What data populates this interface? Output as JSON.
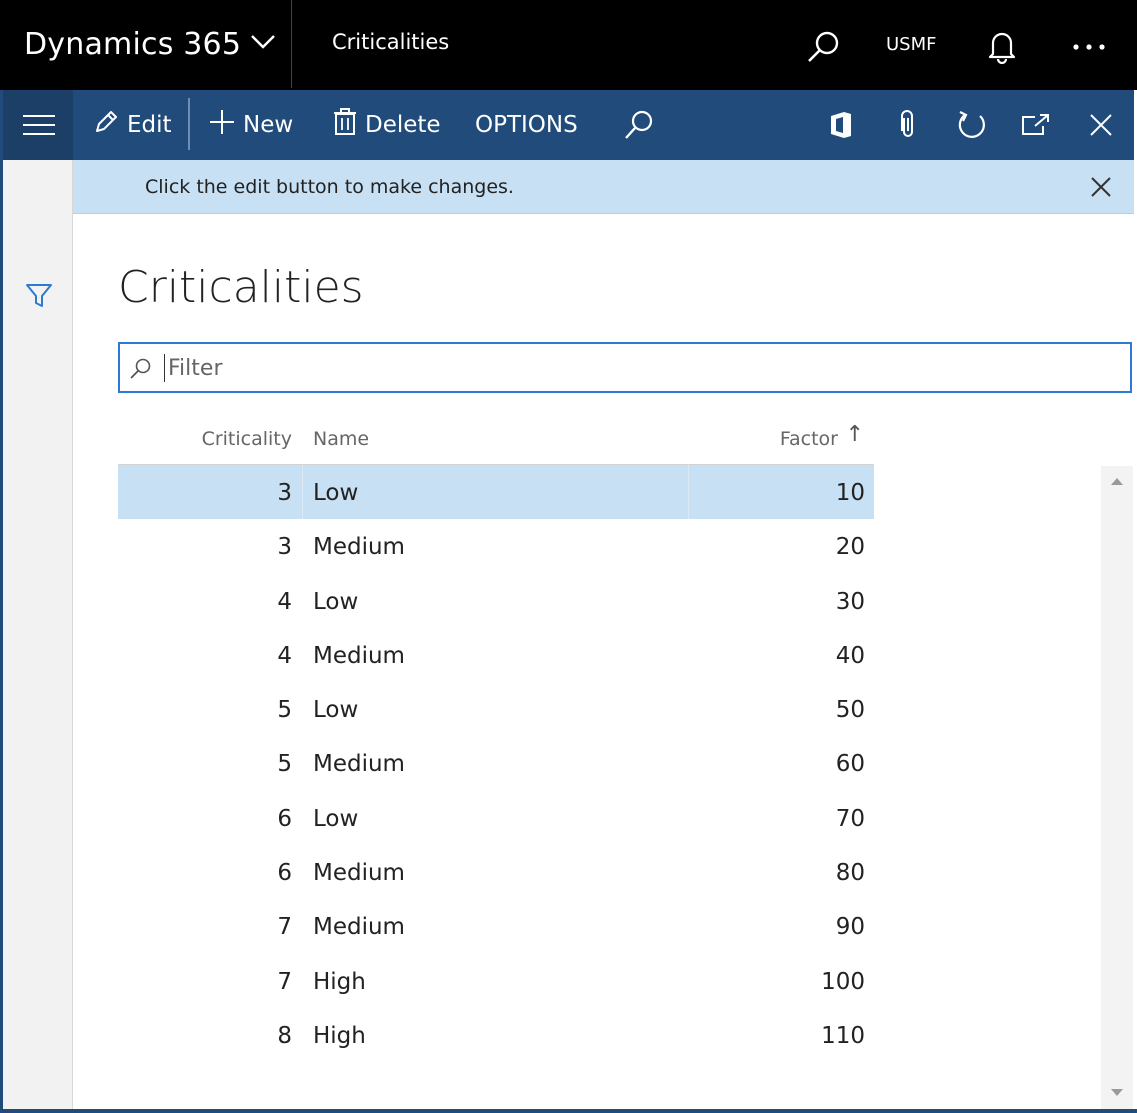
{
  "header": {
    "app_name": "Dynamics 365",
    "page_title": "Criticalities",
    "company": "USMF"
  },
  "actions": {
    "edit": "Edit",
    "new": "New",
    "delete": "Delete",
    "options": "OPTIONS"
  },
  "message": {
    "text": "Click the edit button to make changes."
  },
  "page": {
    "title": "Criticalities"
  },
  "filter": {
    "placeholder": "Filter",
    "value": ""
  },
  "grid": {
    "columns": {
      "criticality": "Criticality",
      "name": "Name",
      "factor": "Factor"
    },
    "sort_indicator": "↑",
    "rows": [
      {
        "criticality": "3",
        "name": "Low",
        "factor": "10",
        "selected": true
      },
      {
        "criticality": "3",
        "name": "Medium",
        "factor": "20"
      },
      {
        "criticality": "4",
        "name": "Low",
        "factor": "30"
      },
      {
        "criticality": "4",
        "name": "Medium",
        "factor": "40"
      },
      {
        "criticality": "5",
        "name": "Low",
        "factor": "50"
      },
      {
        "criticality": "5",
        "name": "Medium",
        "factor": "60"
      },
      {
        "criticality": "6",
        "name": "Low",
        "factor": "70"
      },
      {
        "criticality": "6",
        "name": "Medium",
        "factor": "80"
      },
      {
        "criticality": "7",
        "name": "Medium",
        "factor": "90"
      },
      {
        "criticality": "7",
        "name": "High",
        "factor": "100"
      },
      {
        "criticality": "8",
        "name": "High",
        "factor": "110"
      }
    ]
  },
  "icons": {
    "brand_menu": "chevron-down-icon",
    "global_search": "search-icon",
    "notifications": "bell-icon",
    "more": "more-icon",
    "nav_menu": "hamburger-icon",
    "edit": "pencil-icon",
    "new": "plus-icon",
    "delete": "trash-icon",
    "find": "search-icon",
    "office": "office-icon",
    "attach": "paperclip-icon",
    "refresh": "refresh-icon",
    "open_new": "open-new-window-icon",
    "close": "close-icon",
    "filter_pane": "funnel-icon"
  },
  "colors": {
    "header_bg": "#000000",
    "action_bar": "#204b7a",
    "message_bar": "#c7e0f4",
    "accent": "#2e7ad1",
    "selected_row": "#c7e0f4"
  }
}
